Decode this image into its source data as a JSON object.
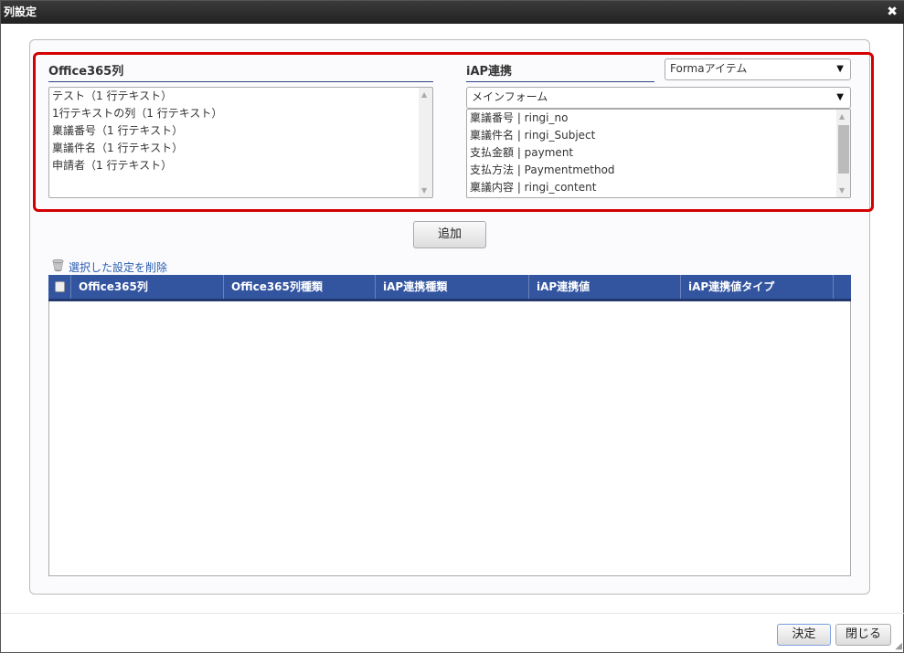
{
  "window": {
    "title": "列設定",
    "close_icon": "close-icon"
  },
  "left": {
    "heading": "Office365列",
    "items": [
      "テスト（1 行テキスト）",
      "1行テキストの列（1 行テキスト）",
      "稟議番号（1 行テキスト）",
      "稟議件名（1 行テキスト）",
      "申請者（1 行テキスト）"
    ]
  },
  "right": {
    "heading": "iAP連携",
    "type_select": "Formaアイテム",
    "form_select": "メインフォーム",
    "items": [
      "稟議番号 | ringi_no",
      "稟議件名 | ringi_Subject",
      "支払金額 | payment",
      "支払方法 | Paymentmethod",
      "稟議内容 | ringi_content"
    ]
  },
  "add_label": "追加",
  "delete_label": "選択した設定を削除",
  "table": {
    "columns": [
      "Office365列",
      "Office365列種類",
      "iAP連携種類",
      "iAP連携値",
      "iAP連携値タイプ"
    ]
  },
  "footer": {
    "ok_label": "決定",
    "close_label": "閉じる"
  },
  "colors": {
    "accent": "#3355a0",
    "highlight": "#d40000"
  }
}
